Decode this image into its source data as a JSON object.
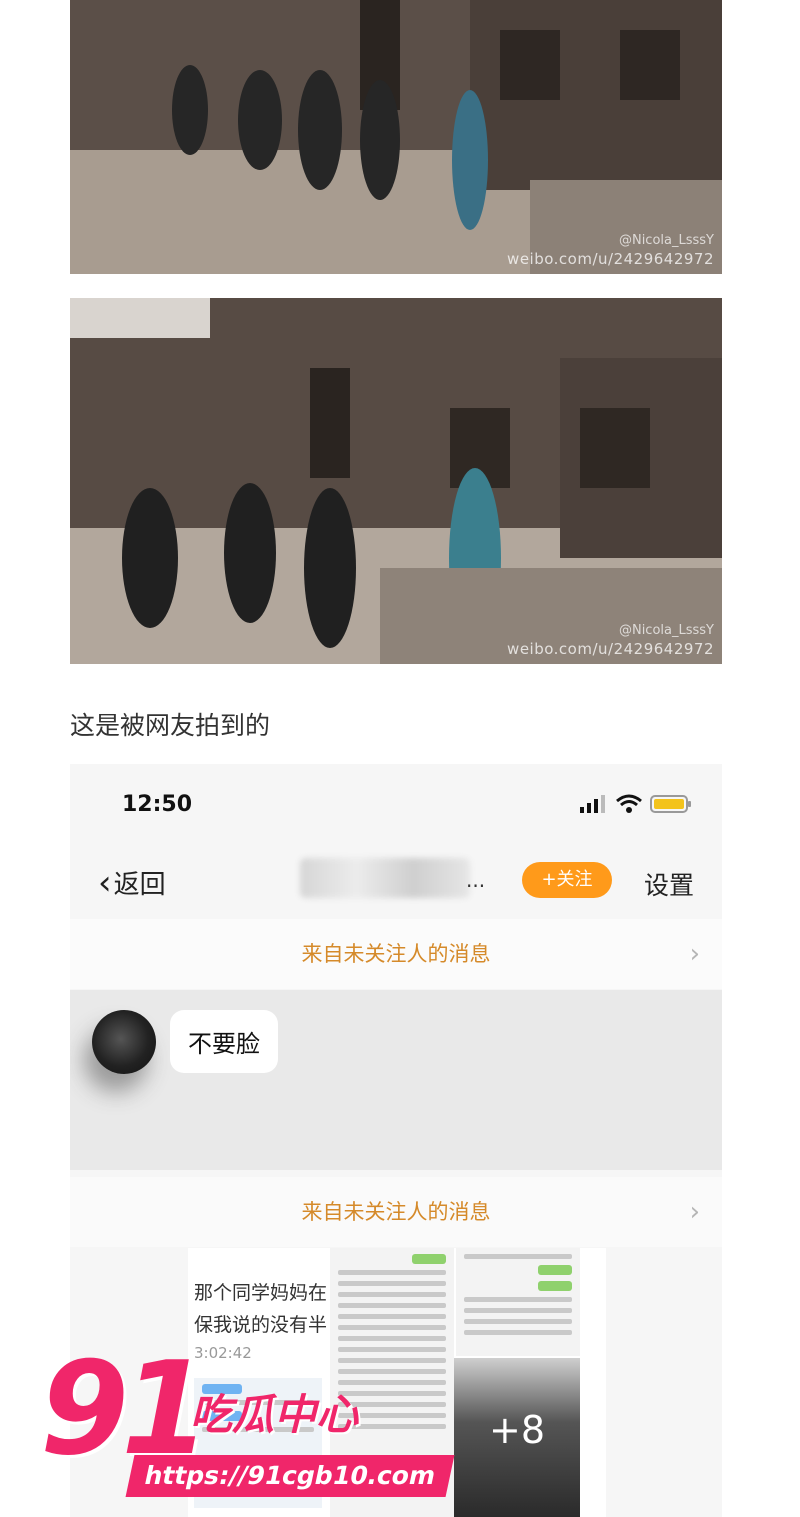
{
  "photos": {
    "watermark_1": "weibo.com/u/2429642972",
    "watermark_1_name": "@Nicola_LsssY",
    "watermark_2": "weibo.com/u/2429642972",
    "watermark_2_name": "@Nicola_LsssY"
  },
  "caption": "这是被网友拍到的",
  "phone": {
    "status": {
      "time": "12:50"
    },
    "nav": {
      "back_label": "返回",
      "follow_label": "+关注",
      "settings_label": "设置",
      "name_ellipsis": "..."
    },
    "banner_text": "来自未关注人的消息",
    "message": "不要脸",
    "thumbnail": {
      "line_1": "那个同学妈妈在",
      "line_2": "保我说的没有半",
      "time": "3:02:42",
      "more_count": "+8"
    }
  },
  "logo": {
    "number": "91",
    "name": "吃瓜中心",
    "url": "https://91cgb10.com"
  },
  "colors": {
    "accent_pink": "#f0266a",
    "follow_orange": "#ff9a1a",
    "banner_text": "#d58a2a"
  }
}
